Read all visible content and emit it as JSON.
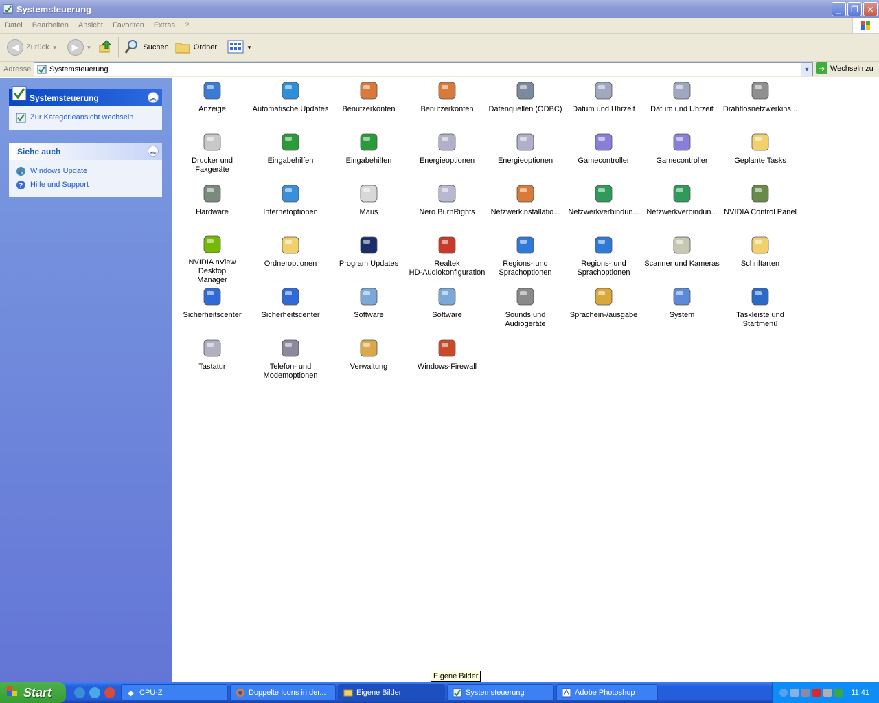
{
  "window": {
    "title": "Systemsteuerung",
    "min": "_",
    "max": "❐",
    "close": "✕"
  },
  "menu": [
    "Datei",
    "Bearbeiten",
    "Ansicht",
    "Favoriten",
    "Extras",
    "?"
  ],
  "toolbar": {
    "back": "Zurück",
    "search": "Suchen",
    "folders": "Ordner"
  },
  "address": {
    "label": "Adresse",
    "value": "Systemsteuerung",
    "go": "Wechseln zu"
  },
  "sidebar": {
    "panel1": {
      "title": "Systemsteuerung",
      "links": [
        "Zur Kategorieansicht wechseln"
      ]
    },
    "panel2": {
      "title": "Siehe auch",
      "links": [
        "Windows Update",
        "Hilfe und Support"
      ]
    }
  },
  "items": [
    {
      "label": "Anzeige",
      "icon": "display-icon",
      "color": "#3a7bd5"
    },
    {
      "label": "Automatische Updates",
      "icon": "windows-update-icon",
      "color": "#2f8fd8"
    },
    {
      "label": "Benutzerkonten",
      "icon": "users-icon",
      "color": "#d9793a"
    },
    {
      "label": "Benutzerkonten",
      "icon": "users-icon",
      "color": "#d9793a"
    },
    {
      "label": "Datenquellen (ODBC)",
      "icon": "database-icon",
      "color": "#7c8aa0"
    },
    {
      "label": "Datum und Uhrzeit",
      "icon": "clock-icon",
      "color": "#a0a8c0"
    },
    {
      "label": "Datum und Uhrzeit",
      "icon": "clock-icon",
      "color": "#a0a8c0"
    },
    {
      "label": "Drahtlosnetzwerkins...",
      "icon": "wireless-icon",
      "color": "#909090"
    },
    {
      "label": "Drucker und\nFaxgeräte",
      "icon": "printer-icon",
      "color": "#c8c8c8"
    },
    {
      "label": "Eingabehilfen",
      "icon": "accessibility-icon",
      "color": "#2b9a3a"
    },
    {
      "label": "Eingabehilfen",
      "icon": "accessibility-icon",
      "color": "#2b9a3a"
    },
    {
      "label": "Energieoptionen",
      "icon": "power-icon",
      "color": "#b0b0c8"
    },
    {
      "label": "Energieoptionen",
      "icon": "power-icon",
      "color": "#b0b0c8"
    },
    {
      "label": "Gamecontroller",
      "icon": "gamepad-icon",
      "color": "#8a7fd8"
    },
    {
      "label": "Gamecontroller",
      "icon": "gamepad-icon",
      "color": "#8a7fd8"
    },
    {
      "label": "Geplante Tasks",
      "icon": "scheduled-tasks-icon",
      "color": "#f2d16b"
    },
    {
      "label": "Hardware",
      "icon": "hardware-icon",
      "color": "#7c8a7c"
    },
    {
      "label": "Internetoptionen",
      "icon": "internet-options-icon",
      "color": "#3a8fd8"
    },
    {
      "label": "Maus",
      "icon": "mouse-icon",
      "color": "#d8d8d8"
    },
    {
      "label": "Nero BurnRights",
      "icon": "nero-icon",
      "color": "#b8b8d0"
    },
    {
      "label": "Netzwerkinstallatio...",
      "icon": "network-setup-icon",
      "color": "#d97a3a"
    },
    {
      "label": "Netzwerkverbindun...",
      "icon": "network-globe-icon",
      "color": "#2f9a5a"
    },
    {
      "label": "Netzwerkverbindun...",
      "icon": "network-globe-icon",
      "color": "#2f9a5a"
    },
    {
      "label": "NVIDIA Control Panel",
      "icon": "nvidia-panel-icon",
      "color": "#6a8a4a"
    },
    {
      "label": "NVIDIA nView Desktop\nManager",
      "icon": "nvidia-eye-icon",
      "color": "#76b900"
    },
    {
      "label": "Ordneroptionen",
      "icon": "folder-options-icon",
      "color": "#f2d16b"
    },
    {
      "label": "Program Updates",
      "icon": "program-updates-icon",
      "color": "#1a2f6a"
    },
    {
      "label": "Realtek\nHD-Audiokonfiguration",
      "icon": "speaker-icon",
      "color": "#c83a2a"
    },
    {
      "label": "Regions- und\nSprachoptionen",
      "icon": "globe-icon",
      "color": "#2f7ad8"
    },
    {
      "label": "Regions- und\nSprachoptionen",
      "icon": "globe-icon",
      "color": "#2f7ad8"
    },
    {
      "label": "Scanner und Kameras",
      "icon": "scanner-icon",
      "color": "#c8c8b0"
    },
    {
      "label": "Schriftarten",
      "icon": "fonts-icon",
      "color": "#f2d16b"
    },
    {
      "label": "Sicherheitscenter",
      "icon": "shield-icon",
      "color": "#2f6ad8"
    },
    {
      "label": "Sicherheitscenter",
      "icon": "shield-icon",
      "color": "#2f6ad8"
    },
    {
      "label": "Software",
      "icon": "software-icon",
      "color": "#7aa8d8"
    },
    {
      "label": "Software",
      "icon": "software-icon",
      "color": "#7aa8d8"
    },
    {
      "label": "Sounds und\nAudiogeräte",
      "icon": "sound-icon",
      "color": "#8a8a8a"
    },
    {
      "label": "Sprachein-/ausgabe",
      "icon": "speech-icon",
      "color": "#d8a83a"
    },
    {
      "label": "System",
      "icon": "system-icon",
      "color": "#5a8ad8"
    },
    {
      "label": "Taskleiste und\nStartmenü",
      "icon": "taskbar-icon",
      "color": "#2a6ac8"
    },
    {
      "label": "Tastatur",
      "icon": "keyboard-icon",
      "color": "#b0b0c0"
    },
    {
      "label": "Telefon- und\nModemoptionen",
      "icon": "phone-icon",
      "color": "#8a8a9a"
    },
    {
      "label": "Verwaltung",
      "icon": "admin-tools-icon",
      "color": "#d8a84a"
    },
    {
      "label": "Windows-Firewall",
      "icon": "firewall-icon",
      "color": "#c84a2a"
    }
  ],
  "tooltip": "Eigene Bilder",
  "taskbar": {
    "start": "Start",
    "tasks": [
      "CPU-Z",
      "Doppelte Icons in der...",
      "Eigene Bilder",
      "Systemsteuerung",
      "Adobe Photoshop"
    ],
    "clock": "11:41"
  }
}
